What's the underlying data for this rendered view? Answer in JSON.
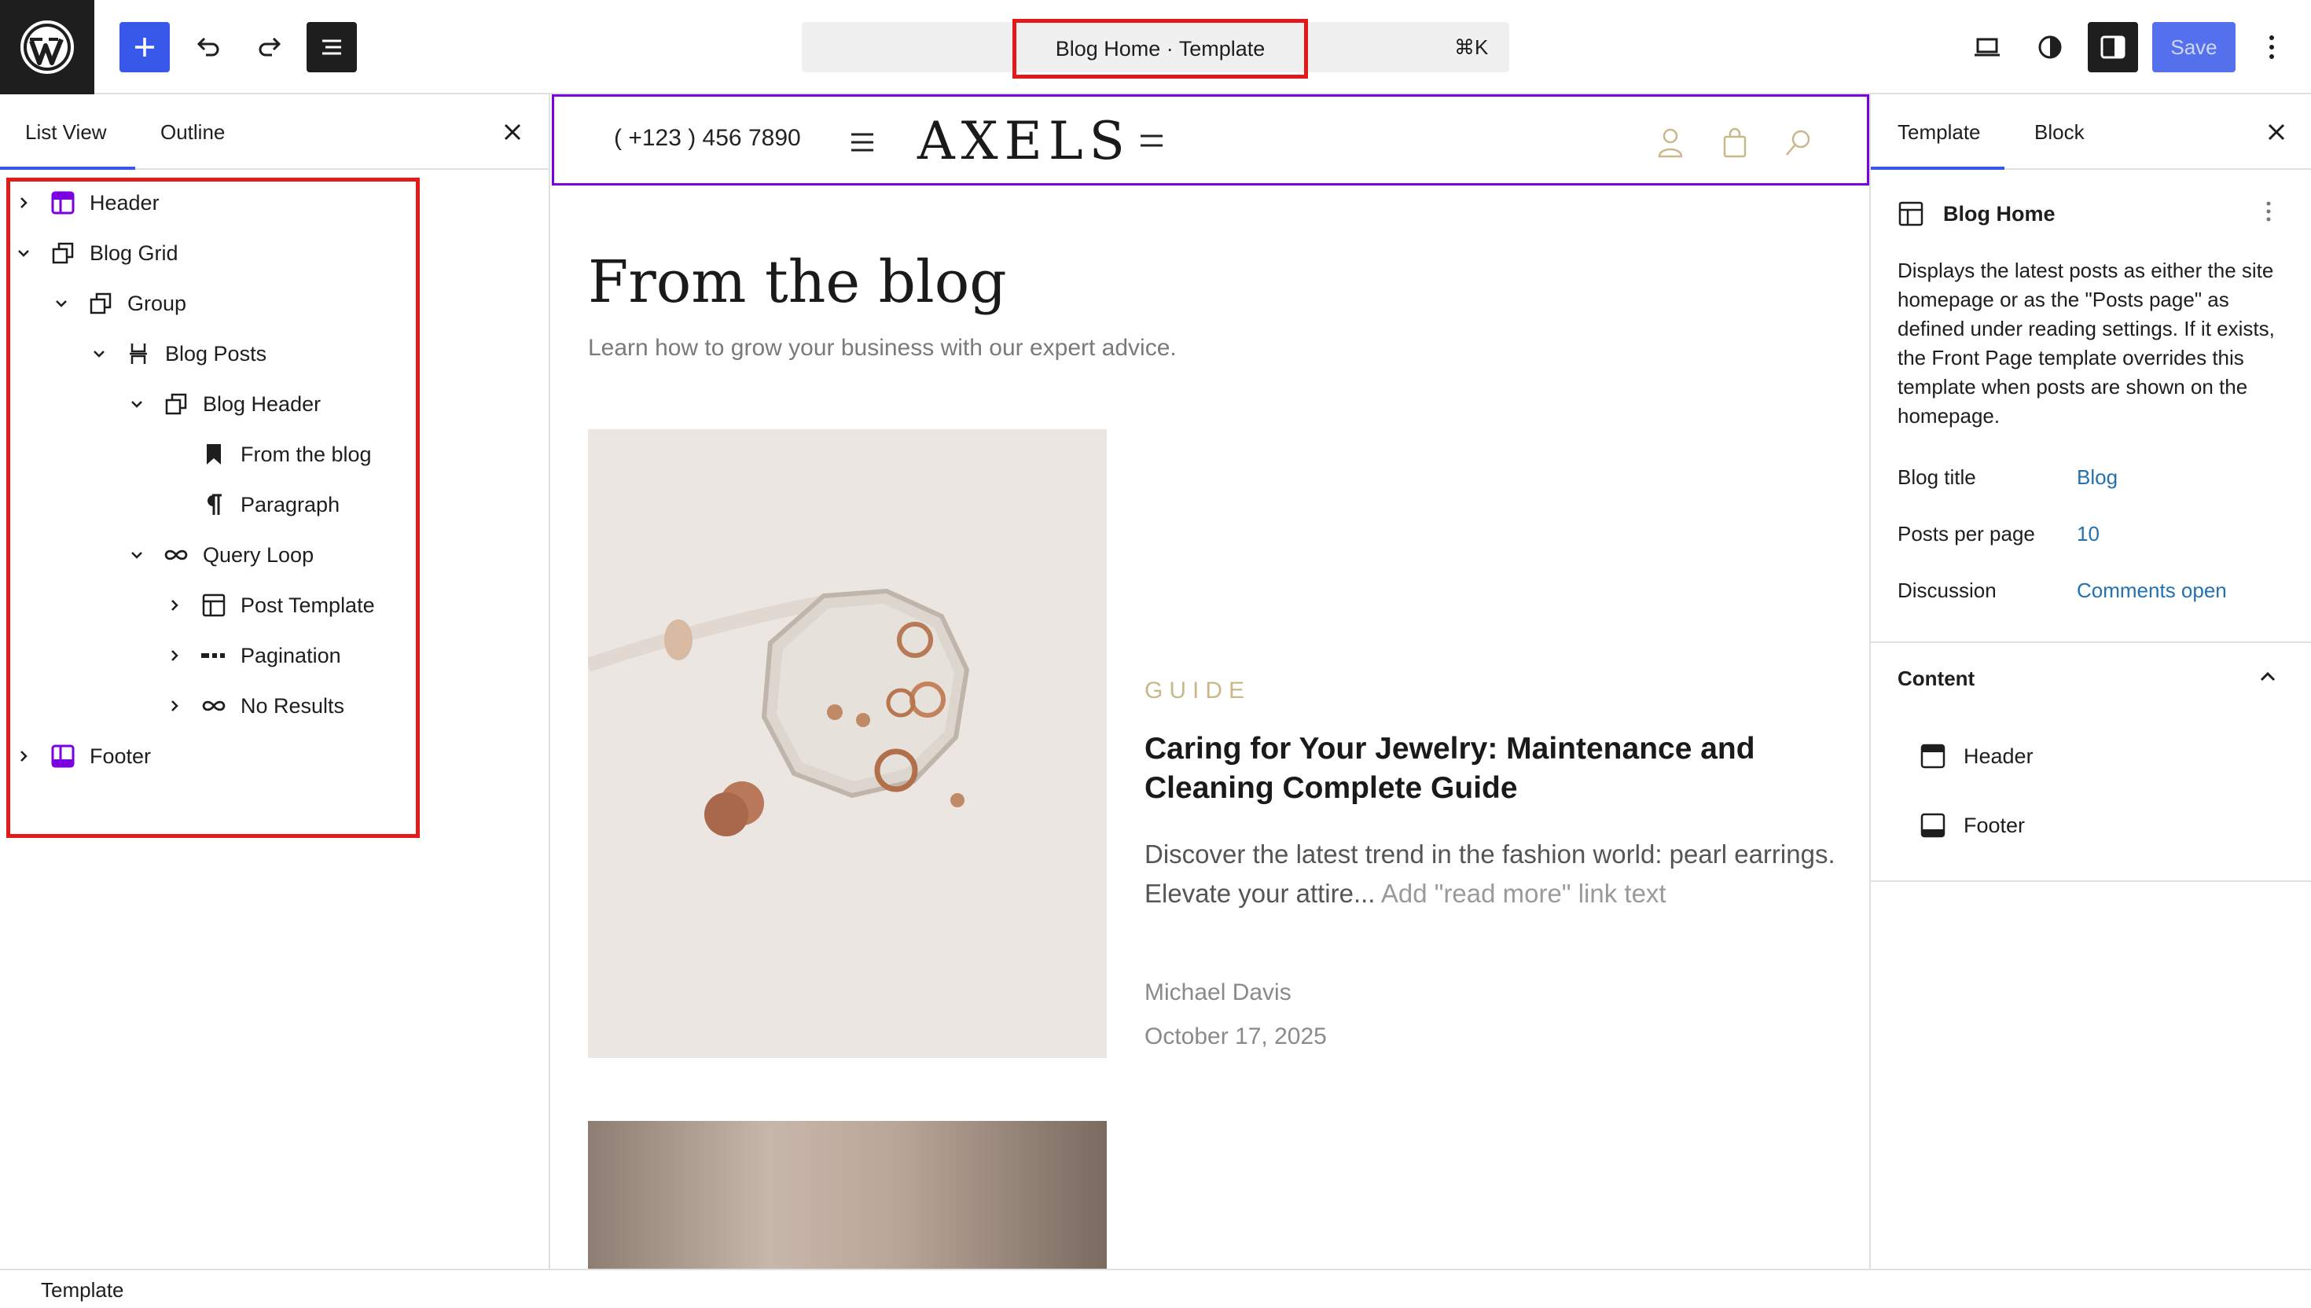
{
  "toolbar": {
    "title": "Blog Home · Template",
    "shortcut": "⌘K",
    "save_label": "Save"
  },
  "left_panel": {
    "tabs": [
      {
        "label": "List View"
      },
      {
        "label": "Outline"
      }
    ],
    "tree": [
      {
        "label": "Header",
        "icon": "template-part-header-icon",
        "expanded": false
      },
      {
        "label": "Blog Grid",
        "icon": "group-icon",
        "expanded": true
      },
      {
        "label": "Group",
        "icon": "group-icon",
        "expanded": true
      },
      {
        "label": "Blog Posts",
        "icon": "stack-icon",
        "expanded": true
      },
      {
        "label": "Blog Header",
        "icon": "group-icon",
        "expanded": true
      },
      {
        "label": "From the blog",
        "icon": "heading-bookmark-icon"
      },
      {
        "label": "Paragraph",
        "icon": "paragraph-icon"
      },
      {
        "label": "Query Loop",
        "icon": "loop-icon",
        "expanded": true
      },
      {
        "label": "Post Template",
        "icon": "layout-icon",
        "expanded": false
      },
      {
        "label": "Pagination",
        "icon": "pagination-icon",
        "expanded": false
      },
      {
        "label": "No Results",
        "icon": "loop-icon",
        "expanded": false
      },
      {
        "label": "Footer",
        "icon": "template-part-footer-icon",
        "expanded": false
      }
    ]
  },
  "canvas": {
    "phone": "( +123 ) 456 7890",
    "logo": "AXELS",
    "blog_title": "From the blog",
    "blog_subtitle": "Learn how to grow your business with our expert advice.",
    "post": {
      "category": "GUIDE",
      "title": "Caring for Your Jewelry: Maintenance and Cleaning Complete Guide",
      "excerpt": "Discover the latest trend in the fashion world: pearl earrings. Elevate your attire...",
      "read_more": "Add \"read more\" link text",
      "author": "Michael Davis",
      "date": "October 17, 2025"
    }
  },
  "right_panel": {
    "tabs": [
      {
        "label": "Template"
      },
      {
        "label": "Block"
      }
    ],
    "template_name": "Blog Home",
    "description": "Displays the latest posts as either the site homepage or as the \"Posts page\" as defined under reading settings. If it exists, the Front Page template overrides this template when posts are shown on the homepage.",
    "properties": [
      {
        "label": "Blog title",
        "value": "Blog"
      },
      {
        "label": "Posts per page",
        "value": "10"
      },
      {
        "label": "Discussion",
        "value": "Comments open"
      }
    ],
    "content_heading": "Content",
    "content_items": [
      {
        "label": "Header"
      },
      {
        "label": "Footer"
      }
    ]
  },
  "footer_bar": {
    "breadcrumb": "Template"
  },
  "colors": {
    "accent": "#3858e9",
    "highlight": "#e21a1a",
    "template_part": "#7a00df",
    "link": "#2271b1",
    "category": "#c9b88a"
  }
}
